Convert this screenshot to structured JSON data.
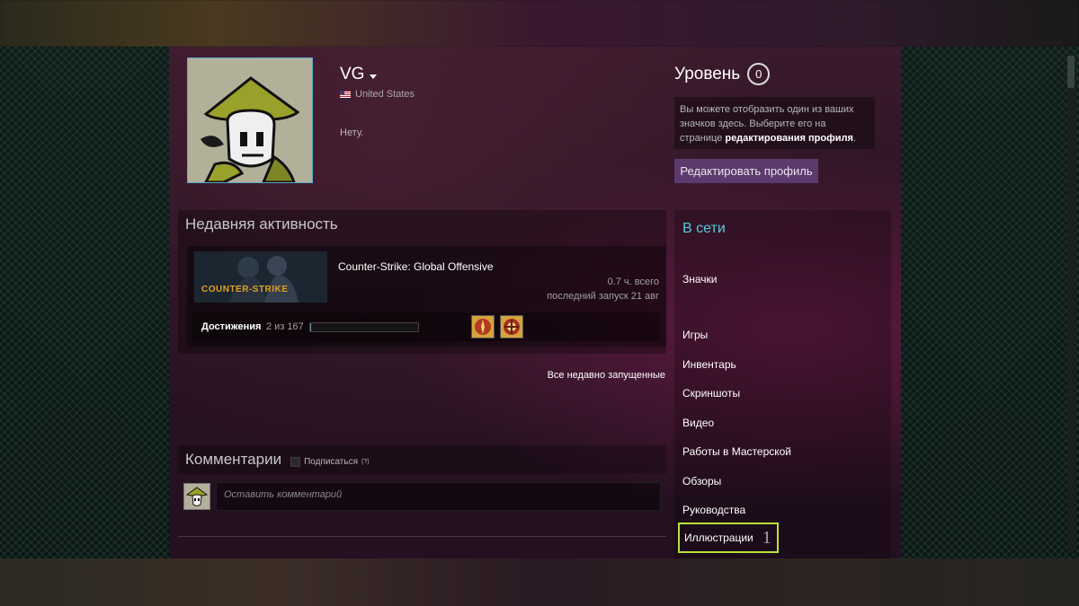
{
  "profile": {
    "name": "VG",
    "location": "United States",
    "summary": "Нету.",
    "level_label": "Уровень",
    "level_value": "0",
    "badge_hint_text": "Вы можете отобразить один из ваших значков здесь. Выберите его на странице ",
    "badge_hint_link": "редактирования профиля",
    "badge_hint_end": ".",
    "edit_button": "Редактировать профиль"
  },
  "recent_activity": {
    "title": "Недавняя активность",
    "game": {
      "name": "Counter-Strike: Global Offensive",
      "capsule_text": "COUNTER-STRIKE",
      "hours": "0.7 ч. всего",
      "last_played": "последний запуск 21 авг",
      "achievements_label": "Достижения",
      "achievements_count": "2 из 167",
      "achievements_progress": 0.012
    },
    "all_recent_link": "Все недавно запущенные"
  },
  "comments": {
    "title": "Комментарии",
    "subscribe_label": "Подписаться",
    "help_mark": "(?)",
    "input_placeholder": "Оставить комментарий"
  },
  "sidebar": {
    "status": "В сети",
    "links": {
      "badges": "Значки",
      "games": "Игры",
      "inventory": "Инвентарь",
      "screenshots": "Скриншоты",
      "videos": "Видео",
      "workshop": "Работы в Мастерской",
      "reviews": "Обзоры",
      "guides": "Руководства"
    },
    "highlighted": {
      "label": "Иллюстрации",
      "count": "1"
    }
  },
  "colors": {
    "online_status": "#57cbde",
    "highlight_border": "#b7e23a",
    "edit_button": "#5c3a6e"
  }
}
